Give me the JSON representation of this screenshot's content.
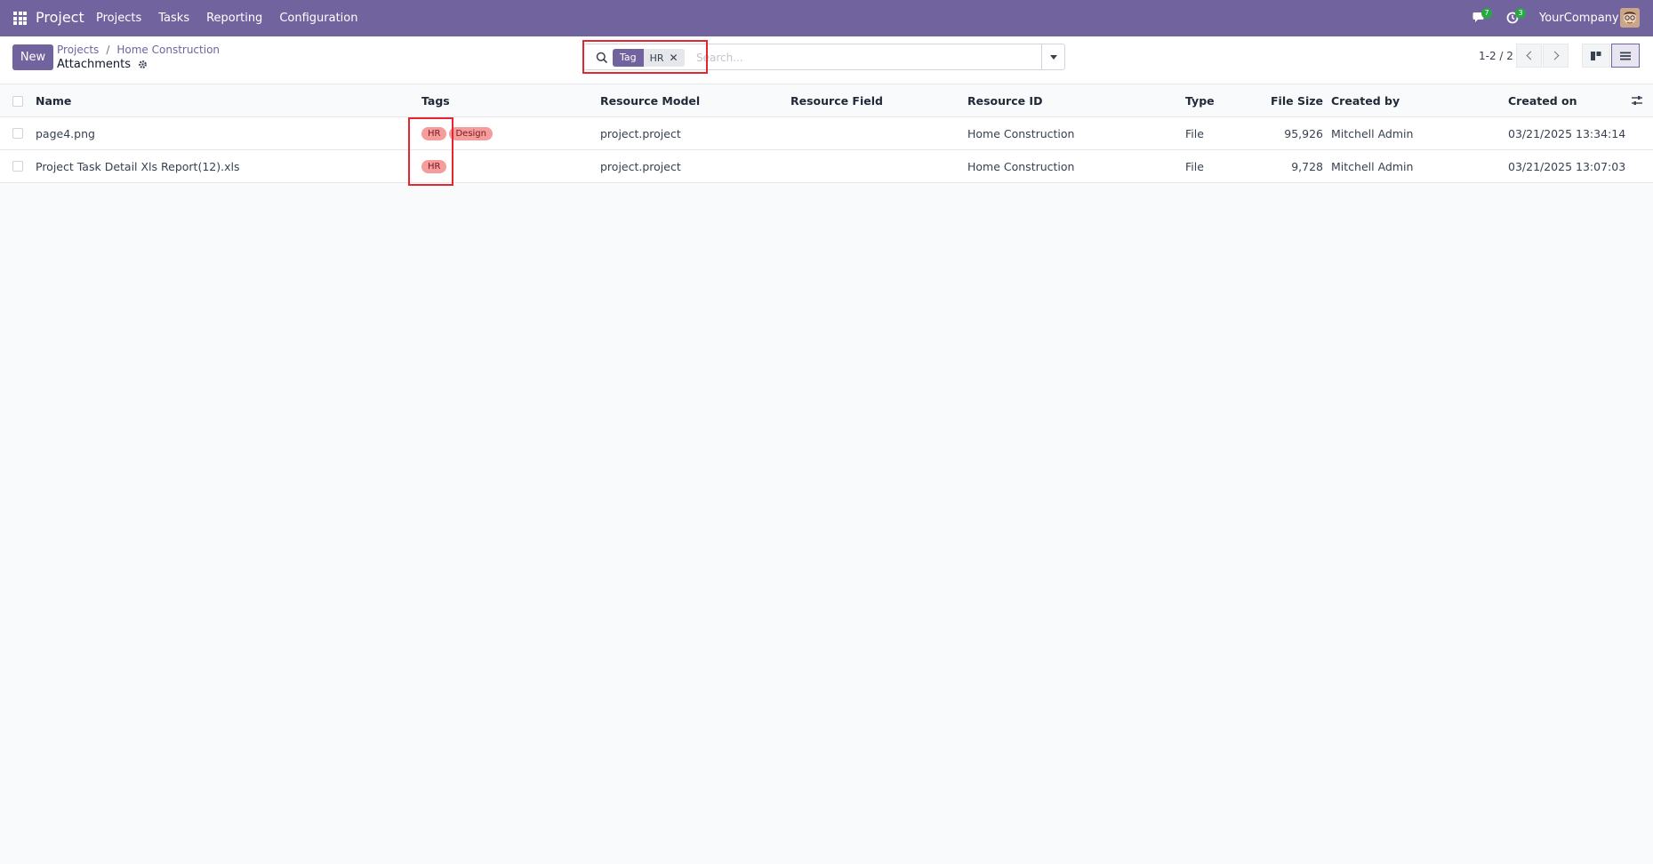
{
  "navbar": {
    "brand": "Project",
    "menu": [
      "Projects",
      "Tasks",
      "Reporting",
      "Configuration"
    ],
    "messages_count": "7",
    "activities_count": "3",
    "company": "YourCompany"
  },
  "control_panel": {
    "new_label": "New",
    "breadcrumb": [
      "Projects",
      "Home Construction"
    ],
    "view_title": "Attachments",
    "search": {
      "facet_label": "Tag",
      "facet_value": "HR",
      "placeholder": "Search..."
    },
    "pager": "1-2 / 2"
  },
  "table": {
    "headers": {
      "name": "Name",
      "tags": "Tags",
      "resource_model": "Resource Model",
      "resource_field": "Resource Field",
      "resource_id": "Resource ID",
      "type": "Type",
      "file_size": "File Size",
      "created_by": "Created by",
      "created_on": "Created on"
    },
    "rows": [
      {
        "name": "page4.png",
        "tags": [
          "HR",
          "Design"
        ],
        "resource_model": "project.project",
        "resource_field": "",
        "resource_id": "Home Construction",
        "type": "File",
        "file_size": "95,926",
        "created_by": "Mitchell Admin",
        "created_on": "03/21/2025 13:34:14"
      },
      {
        "name": "Project Task Detail Xls Report(12).xls",
        "tags": [
          "HR"
        ],
        "resource_model": "project.project",
        "resource_field": "",
        "resource_id": "Home Construction",
        "type": "File",
        "file_size": "9,728",
        "created_by": "Mitchell Admin",
        "created_on": "03/21/2025 13:07:03"
      }
    ]
  },
  "colors": {
    "brand": "#71639e",
    "tag_bg": "#f59c9c",
    "highlight": "#e3262f"
  }
}
